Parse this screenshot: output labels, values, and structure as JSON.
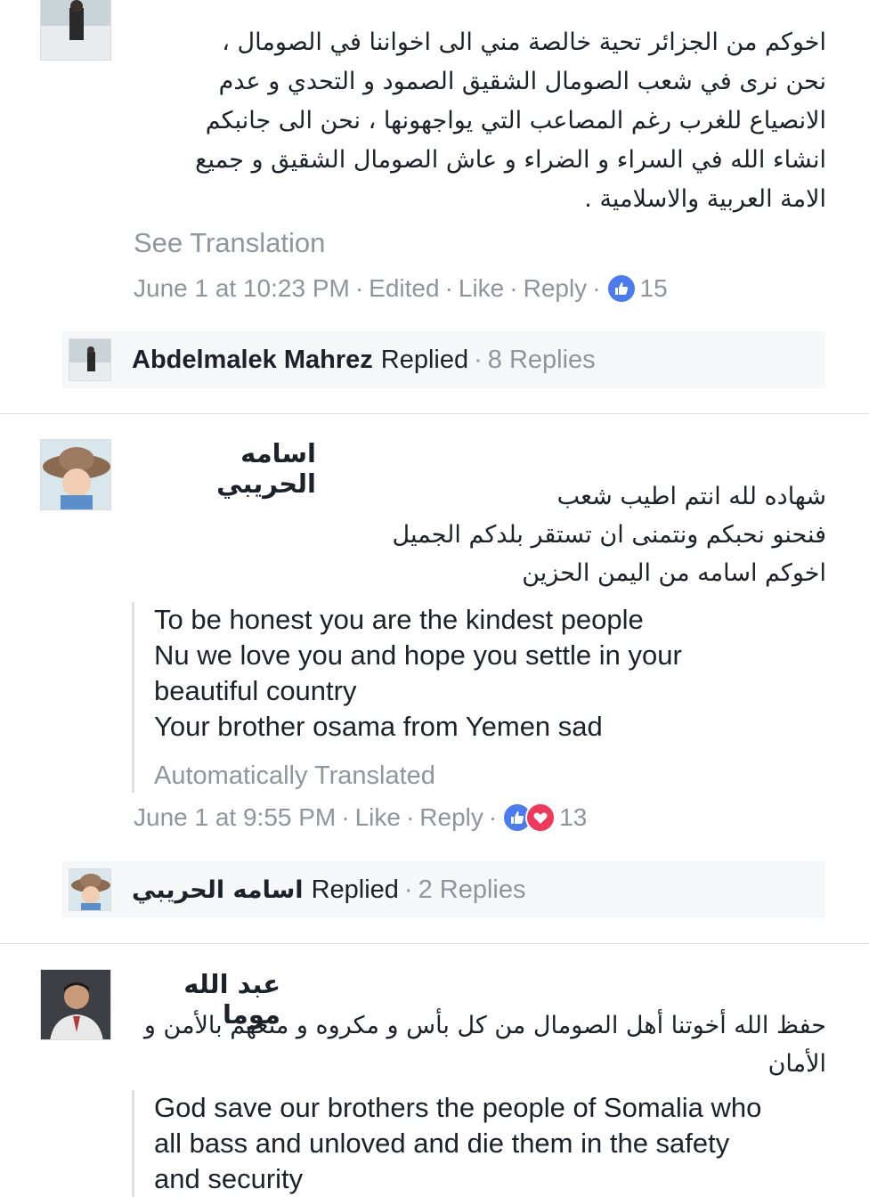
{
  "comments": [
    {
      "text_lines": [
        "اخوكم من الجزائر تحية خالصة مني الى اخواننا في الصومال ،",
        "نحن نرى في شعب الصومال الشقيق الصمود و التحدي و عدم",
        "الانصياع للغرب رغم المصاعب التي يواجهونها ، نحن الى جانبكم",
        "انشاء الله في السراء و الضراء و عاش الصومال الشقيق و جميع",
        "الامة العربية والاسلامية ."
      ],
      "see_translation": "See Translation",
      "timestamp": "June 1 at 10:23 PM",
      "edited": "Edited",
      "like": "Like",
      "reply": "Reply",
      "reaction_count": "15",
      "replies_bar": {
        "name": "Abdelmalek Mahrez",
        "replied": "Replied",
        "count": "8 Replies"
      }
    },
    {
      "author": "اسامه الحريبي",
      "text_lines": [
        "شهاده لله انتم اطيب شعب",
        "فنحنو نحبكم ونتمنى ان تستقر بلدكم الجميل",
        "اخوكم اسامه من اليمن الحزين"
      ],
      "translation_lines": [
        "To be honest you are the kindest people",
        "Nu we love you and hope you settle in your",
        "beautiful country",
        "Your brother osama from Yemen sad"
      ],
      "auto_translated": "Automatically Translated",
      "timestamp": "June 1 at 9:55 PM",
      "like": "Like",
      "reply": "Reply",
      "reaction_count": "13",
      "replies_bar": {
        "name": "اسامه الحريبي",
        "replied": "Replied",
        "count": "2 Replies"
      }
    },
    {
      "author": "عبد الله موما",
      "text_lines": [
        "حفظ الله أخوتنا أهل الصومال من كل بأس و مكروه و متعهم بالأمن و",
        "الأمان"
      ],
      "translation_lines": [
        "God save our brothers the people of Somalia who",
        "all bass and unloved and die them in the safety",
        "and security"
      ]
    }
  ],
  "colors": {
    "meta_gray": "#90949c",
    "like_blue": "#4a7bf0",
    "love_red": "#f0385a",
    "bar_bg": "#f6f7f9"
  }
}
